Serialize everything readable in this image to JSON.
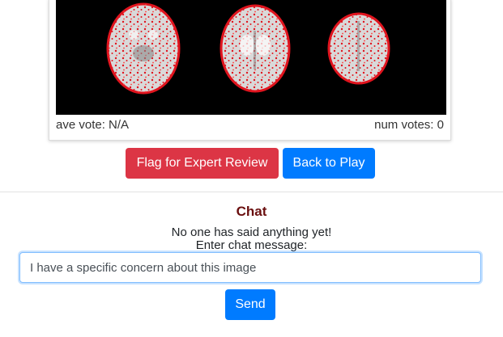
{
  "card": {
    "scan_image": "brain-mri-slices",
    "ave_vote": "ave vote: N/A",
    "num_votes": "num votes: 0"
  },
  "actions": {
    "flag_label": "Flag for Expert Review",
    "back_label": "Back to Play"
  },
  "chat": {
    "title": "Chat",
    "empty_message": "No one has said anything yet!",
    "prompt": "Enter chat message:",
    "input_value": "I have a specific concern about this image",
    "send_label": "Send"
  },
  "colors": {
    "danger": "#dc3545",
    "primary": "#007bff",
    "chat_title": "#6a0f0f",
    "overlay": "#e0141e"
  }
}
